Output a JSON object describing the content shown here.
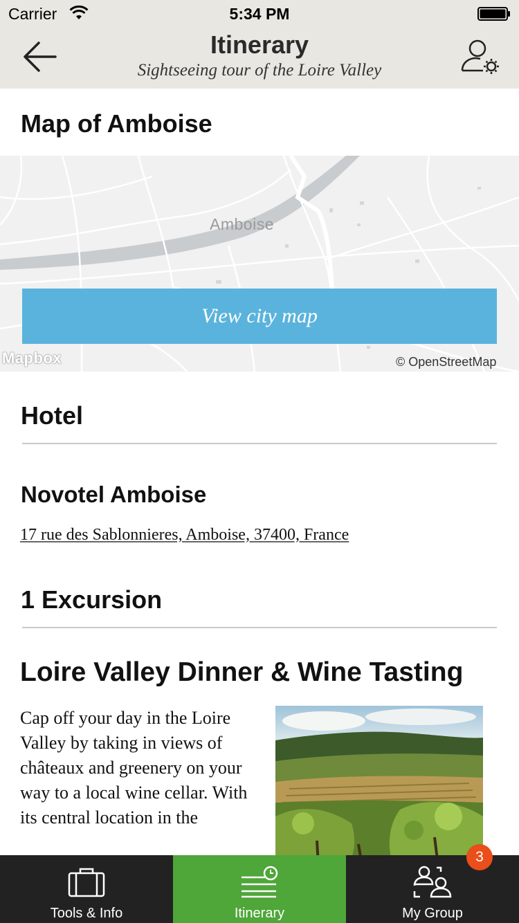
{
  "status_bar": {
    "carrier": "Carrier",
    "time": "5:34 PM"
  },
  "nav": {
    "title": "Itinerary",
    "subtitle": "Sightseeing tour of the Loire Valley",
    "back_icon": "arrow-left-icon",
    "profile_icon": "user-settings-icon"
  },
  "map_section": {
    "heading": "Map of Amboise",
    "city_label": "Amboise",
    "button_label": "View city map",
    "logo": "Mapbox",
    "attribution": "© OpenStreetMap"
  },
  "hotel_section": {
    "heading": "Hotel",
    "name": "Novotel Amboise",
    "address": "17 rue des Sablonnieres, Amboise, 37400, France"
  },
  "excursion_section": {
    "heading": "1 Excursion",
    "title": "Loire Valley Dinner & Wine Tasting",
    "description": "Cap off your day in the Loire Valley by taking in views of châteaux and greenery on your way to a local wine cellar. With its central location in the"
  },
  "tab_bar": {
    "tabs": [
      {
        "label": "Tools & Info",
        "icon": "suitcase-icon",
        "active": false
      },
      {
        "label": "Itinerary",
        "icon": "itinerary-clock-icon",
        "active": true
      },
      {
        "label": "My Group",
        "icon": "group-icon",
        "active": false
      }
    ],
    "badge_count": "3"
  },
  "colors": {
    "nav_background": "#e8e7e1",
    "map_button": "#5ab3dc",
    "tab_bar_background": "#222222",
    "tab_active": "#4fa639",
    "badge": "#e94e1b"
  }
}
